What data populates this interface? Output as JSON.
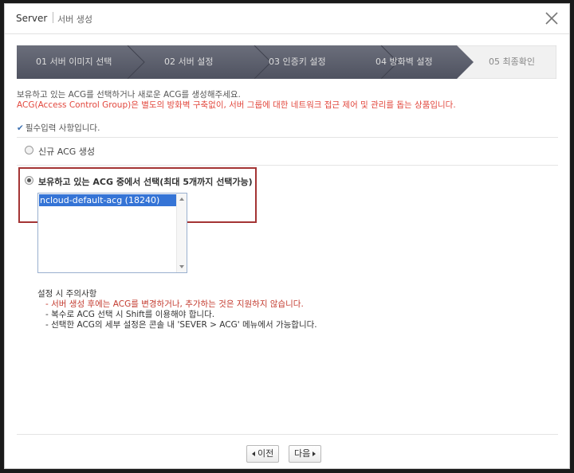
{
  "window": {
    "title": "Server",
    "subtitle": "서버 생성"
  },
  "steps": [
    {
      "label": "01 서버 이미지 선택",
      "state": "done"
    },
    {
      "label": "02 서버 설정",
      "state": "done"
    },
    {
      "label": "03 인증키 설정",
      "state": "done"
    },
    {
      "label": "04 방화벽 설정",
      "state": "current"
    },
    {
      "label": "05 최종확인",
      "state": "todo"
    }
  ],
  "info": {
    "line1": "보유하고 있는 ACG를 선택하거나 새로운 ACG를 생성해주세요.",
    "line2": "ACG(Access Control Group)은 별도의 방화벽 구축없이, 서버 그룹에 대한 네트워크 접근 제어 및 관리를 돕는 상품입니다."
  },
  "required_note": "필수입력 사항입니다.",
  "options": {
    "new_acg": "신규 ACG 생성",
    "existing_acg": "보유하고 있는 ACG 중에서 선택(최대 5개까지 선택가능)"
  },
  "acg_list": [
    "ncloud-default-acg (18240)"
  ],
  "notes": {
    "heading": "설정 시 주의사항",
    "items": [
      "- 서버 생성 후에는 ACG를 변경하거나, 추가하는 것은 지원하지 않습니다.",
      "- 복수로 ACG 선택 시 Shift를 이용해야 합니다.",
      "- 선택한 ACG의 세부 설정은 콘솔 내 'SEVER > ACG' 메뉴에서 가능합니다."
    ]
  },
  "buttons": {
    "prev": "이전",
    "next": "다음"
  },
  "colors": {
    "step_dark": "#5b5e6b",
    "step_light": "#f0f0f0",
    "warning_red": "#e2483e",
    "highlight_border": "#a43434",
    "selection_blue": "#3574d6"
  }
}
